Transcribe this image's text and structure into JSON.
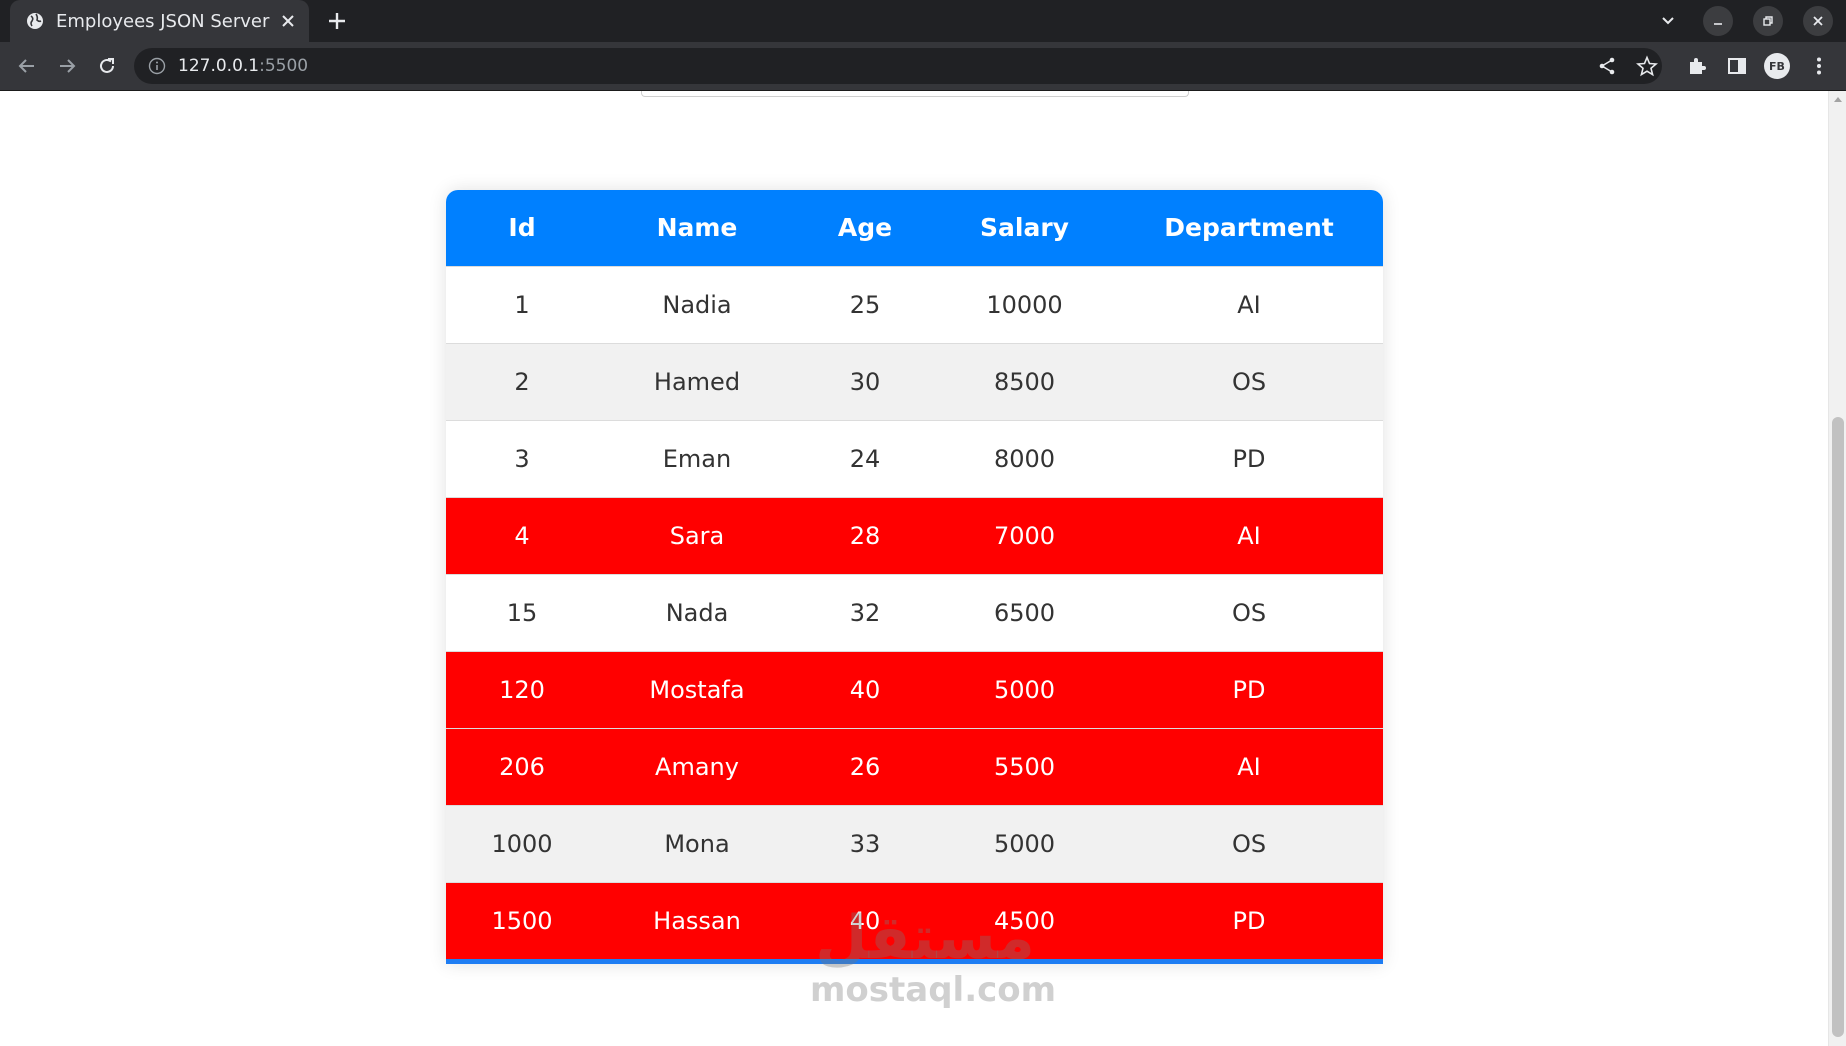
{
  "browser": {
    "tab_title": "Employees JSON Server",
    "url_host": "127.0.0.1",
    "url_port": ":5500",
    "profile_initials": "FB"
  },
  "table": {
    "headers": [
      "Id",
      "Name",
      "Age",
      "Salary",
      "Department"
    ],
    "rows": [
      {
        "id": "1",
        "name": "Nadia",
        "age": "25",
        "salary": "10000",
        "department": "AI",
        "highlight": false
      },
      {
        "id": "2",
        "name": "Hamed",
        "age": "30",
        "salary": "8500",
        "department": "OS",
        "highlight": false
      },
      {
        "id": "3",
        "name": "Eman",
        "age": "24",
        "salary": "8000",
        "department": "PD",
        "highlight": false
      },
      {
        "id": "4",
        "name": "Sara",
        "age": "28",
        "salary": "7000",
        "department": "AI",
        "highlight": true
      },
      {
        "id": "15",
        "name": "Nada",
        "age": "32",
        "salary": "6500",
        "department": "OS",
        "highlight": false
      },
      {
        "id": "120",
        "name": "Mostafa",
        "age": "40",
        "salary": "5000",
        "department": "PD",
        "highlight": true
      },
      {
        "id": "206",
        "name": "Amany",
        "age": "26",
        "salary": "5500",
        "department": "AI",
        "highlight": true
      },
      {
        "id": "1000",
        "name": "Mona",
        "age": "33",
        "salary": "5000",
        "department": "OS",
        "highlight": false
      },
      {
        "id": "1500",
        "name": "Hassan",
        "age": "40",
        "salary": "4500",
        "department": "PD",
        "highlight": true
      }
    ]
  },
  "watermark": {
    "arabic": "مستقل",
    "latin": "mostaql.com"
  },
  "colors": {
    "header_bg": "#0080ff",
    "highlight_row": "#ff0000",
    "alt_row": "#f1f1f1"
  },
  "icons": [
    "globe-icon",
    "close-icon",
    "plus-icon",
    "chevron-down-icon",
    "minimize-icon",
    "restore-icon",
    "back-icon",
    "forward-icon",
    "reload-icon",
    "info-icon",
    "share-icon",
    "star-icon",
    "puzzle-icon",
    "side-panel-icon",
    "kebab-menu-icon"
  ]
}
